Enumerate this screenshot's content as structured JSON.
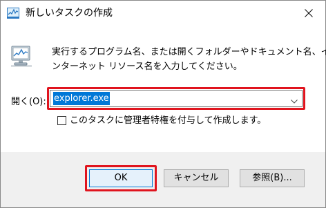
{
  "window": {
    "title": "新しいタスクの作成"
  },
  "description": {
    "line1": "実行するプログラム名、または開くフォルダーやドキュメント名、イ",
    "line2": "ンターネット リソース名を入力してください。"
  },
  "open_field": {
    "label": "開く(O):",
    "value": "explorer.exe"
  },
  "admin_checkbox": {
    "label": "このタスクに管理者特権を付与して作成します。",
    "checked": false
  },
  "buttons": {
    "ok": "OK",
    "cancel": "キャンセル",
    "browse": "参照(B)..."
  },
  "colors": {
    "highlight": "#e0141e",
    "selection": "#0078d7"
  },
  "icons": {
    "title": "task-manager-icon",
    "run": "run-dialog-icon",
    "close": "close-icon",
    "dropdown": "chevron-down-icon"
  }
}
